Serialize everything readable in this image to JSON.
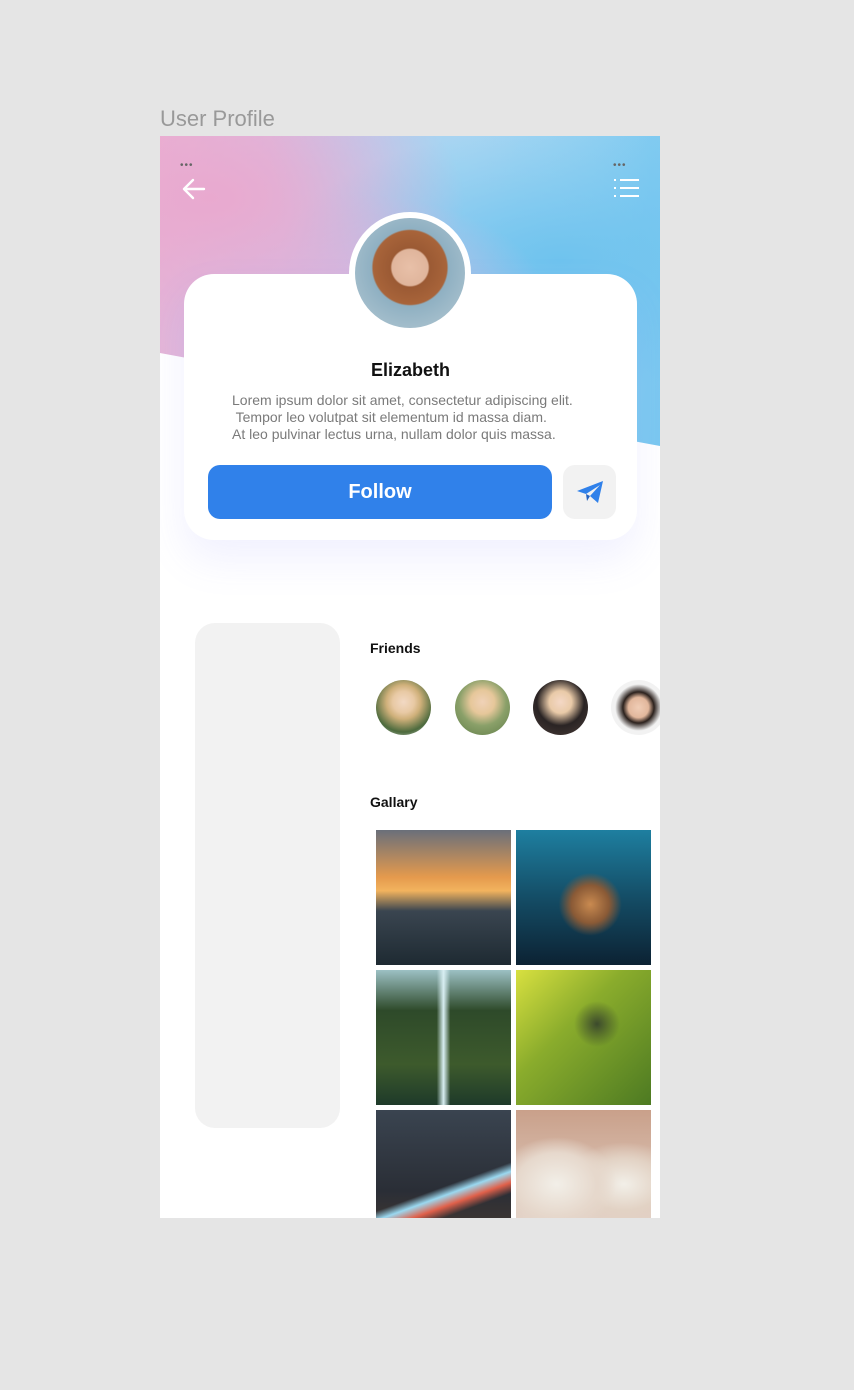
{
  "page_title": "User Profile",
  "header": {
    "left_dots": "•••",
    "right_dots": "•••",
    "back_icon": "arrow-left-icon",
    "menu_icon": "list-icon"
  },
  "profile": {
    "name": "Elizabeth",
    "description": "Lorem ipsum dolor sit amet, consectetur adipiscing elit.\n Tempor leo volutpat sit elementum id massa diam.\nAt leo pulvinar lectus urna, nullam dolor quis massa.",
    "follow_label": "Follow",
    "send_icon": "paper-plane-icon"
  },
  "colors": {
    "accent": "#3081ea",
    "muted": "#f2f2f2"
  },
  "friends": {
    "title": "Friends"
  },
  "gallery": {
    "title": "Gallary"
  }
}
